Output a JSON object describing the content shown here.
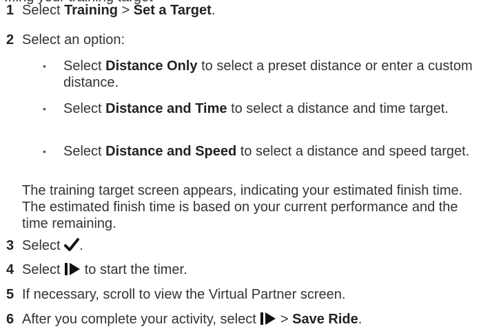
{
  "cut_line": "...ing your training target",
  "steps": [
    {
      "num": "1",
      "pre": "Select ",
      "b1": "Training",
      "mid": " > ",
      "b2": "Set a Target",
      "post": "."
    },
    {
      "num": "2",
      "text": "Select an option:"
    },
    {
      "num": "3",
      "pre": "Select ",
      "post": "."
    },
    {
      "num": "4",
      "pre": "Select ",
      "post": " to start the timer."
    },
    {
      "num": "5",
      "text": "If necessary, scroll to view the Virtual Partner screen."
    },
    {
      "num": "6",
      "pre": "After you complete your activity, select ",
      "mid": " > ",
      "b": "Save Ride",
      "post": "."
    }
  ],
  "options": [
    {
      "pre": "Select ",
      "b": "Distance Only",
      "post": " to select a preset distance or enter a custom distance."
    },
    {
      "pre": "Select ",
      "b": "Distance and Time",
      "post": " to select a distance and time target."
    },
    {
      "pre": "Select ",
      "b": "Distance and Speed",
      "post": " to select a distance and speed target."
    }
  ],
  "paragraph": "The training target screen appears, indicating your estimated finish time. The estimated finish time is based on your current performance and the time remaining.",
  "icons": {
    "check": "checkmark-icon",
    "start_stop": "start-stop-icon"
  }
}
